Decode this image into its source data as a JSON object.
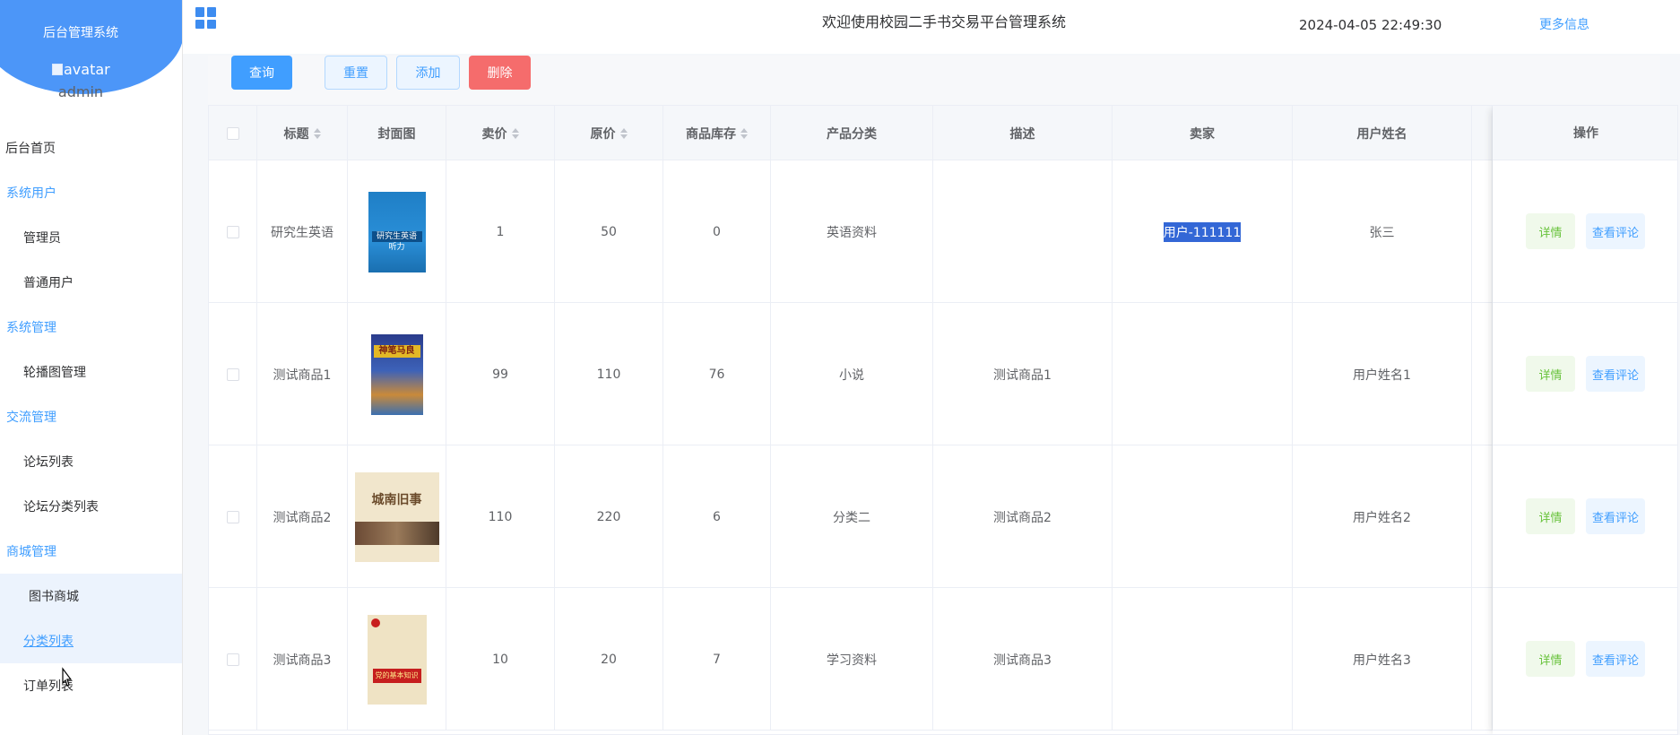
{
  "sidebar": {
    "brand_title": "后台管理系统",
    "avatar_alt": "avatar",
    "username": "admin",
    "menu": [
      {
        "label": "后台首页",
        "kind": "top"
      },
      {
        "label": "系统用户",
        "kind": "group"
      },
      {
        "label": "管理员",
        "kind": "sub"
      },
      {
        "label": "普通用户",
        "kind": "sub"
      },
      {
        "label": "系统管理",
        "kind": "group"
      },
      {
        "label": "轮播图管理",
        "kind": "sub"
      },
      {
        "label": "交流管理",
        "kind": "group"
      },
      {
        "label": "论坛列表",
        "kind": "sub"
      },
      {
        "label": "论坛分类列表",
        "kind": "sub"
      },
      {
        "label": "商城管理",
        "kind": "group"
      },
      {
        "label": "图书商城",
        "kind": "sub",
        "state": "active"
      },
      {
        "label": "分类列表",
        "kind": "sub",
        "state": "hover"
      },
      {
        "label": "订单列表",
        "kind": "sub"
      }
    ]
  },
  "header": {
    "welcome": "欢迎使用校园二手书交易平台管理系统",
    "datetime": "2024-04-05 22:49:30",
    "more_info": "更多信息",
    "menu_icon": "grid-icon"
  },
  "toolbar": {
    "query": "查询",
    "reset": "重置",
    "add": "添加",
    "delete": "删除"
  },
  "table": {
    "columns": [
      "标题",
      "封面图",
      "卖价",
      "原价",
      "商品库存",
      "产品分类",
      "描述",
      "卖家",
      "用户姓名",
      "操作"
    ],
    "rows": [
      {
        "title": "研究生英语",
        "cover": "研究生英语 听力",
        "price": "1",
        "original": "50",
        "stock": "0",
        "category": "英语资料",
        "desc": "",
        "seller": "用户-111111",
        "name": "张三"
      },
      {
        "title": "测试商品1",
        "cover": "神笔马良",
        "price": "99",
        "original": "110",
        "stock": "76",
        "category": "小说",
        "desc": "测试商品1",
        "seller": "",
        "name": "用户姓名1"
      },
      {
        "title": "测试商品2",
        "cover": "城南旧事",
        "price": "110",
        "original": "220",
        "stock": "6",
        "category": "分类二",
        "desc": "测试商品2",
        "seller": "",
        "name": "用户姓名2"
      },
      {
        "title": "测试商品3",
        "cover": "党的基本知识",
        "price": "10",
        "original": "20",
        "stock": "7",
        "category": "学习资料",
        "desc": "测试商品3",
        "seller": "",
        "name": "用户姓名3"
      }
    ],
    "actions": {
      "detail": "详情",
      "comments": "查看评论"
    }
  }
}
